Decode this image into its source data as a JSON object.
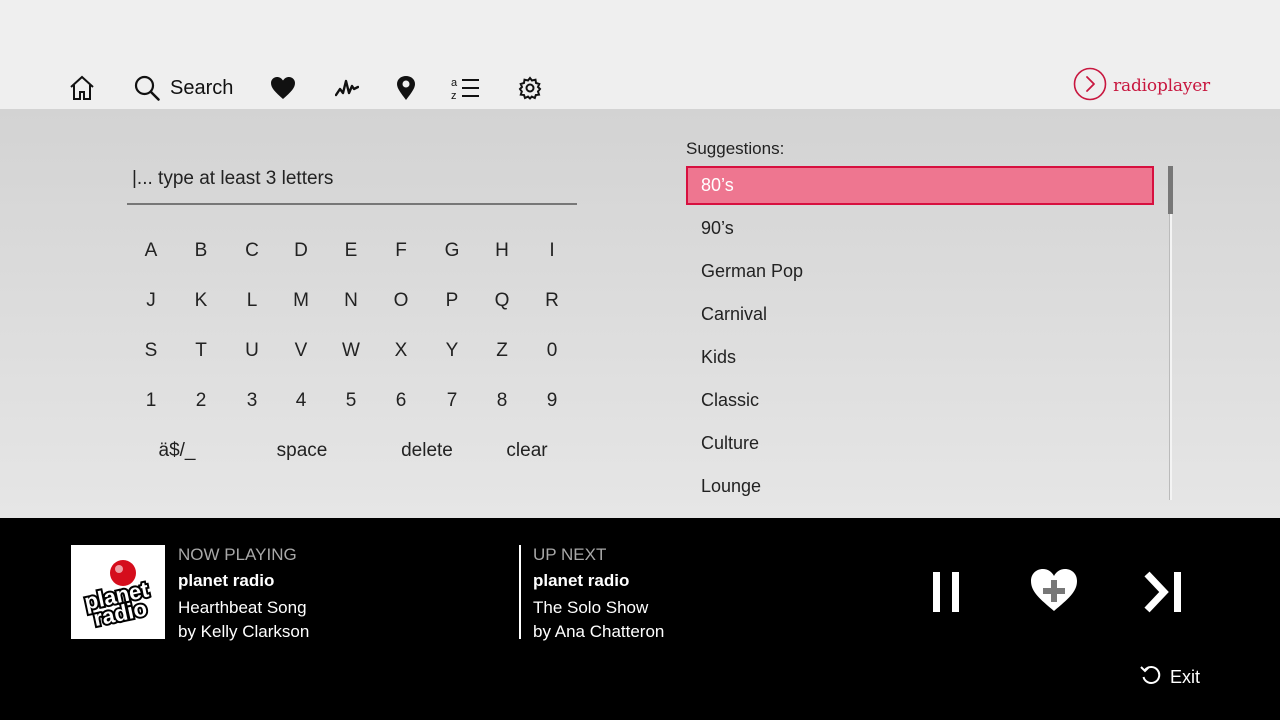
{
  "nav": {
    "search_label": "Search",
    "brand_name": "radioplayer",
    "icons": [
      "home-icon",
      "search-icon",
      "heart-icon",
      "pulse-icon",
      "location-pin-icon",
      "az-list-icon",
      "gear-icon"
    ]
  },
  "search": {
    "placeholder": "|... type at least 3 letters"
  },
  "keyboard": {
    "rows": [
      [
        "A",
        "B",
        "C",
        "D",
        "E",
        "F",
        "G",
        "H",
        "I"
      ],
      [
        "J",
        "K",
        "L",
        "M",
        "N",
        "O",
        "P",
        "Q",
        "R"
      ],
      [
        "S",
        "T",
        "U",
        "V",
        "W",
        "X",
        "Y",
        "Z",
        "0"
      ],
      [
        "1",
        "2",
        "3",
        "4",
        "5",
        "6",
        "7",
        "8",
        "9"
      ]
    ],
    "special": [
      "ä$/_",
      "space",
      "delete",
      "clear"
    ]
  },
  "suggestions": {
    "title": "Suggestions:",
    "items": [
      "80’s",
      "90’s",
      "German Pop",
      "Carnival",
      "Kids",
      "Classic",
      "Culture",
      "Lounge"
    ],
    "selected_index": 0
  },
  "now_playing": {
    "heading": "NOW PLAYING",
    "station": "planet radio",
    "song": "Hearthbeat Song",
    "artist": "by Kelly Clarkson",
    "logo_text_1": "planet",
    "logo_text_2": "radio"
  },
  "up_next": {
    "heading": "UP NEXT",
    "station": "planet radio",
    "show": "The Solo Show",
    "host": "by Ana Chatteron"
  },
  "controls": {
    "exit_label": "Exit"
  },
  "colors": {
    "accent": "#c8173f",
    "selected_bg": "#ee7690",
    "selected_border": "#d7103f"
  }
}
